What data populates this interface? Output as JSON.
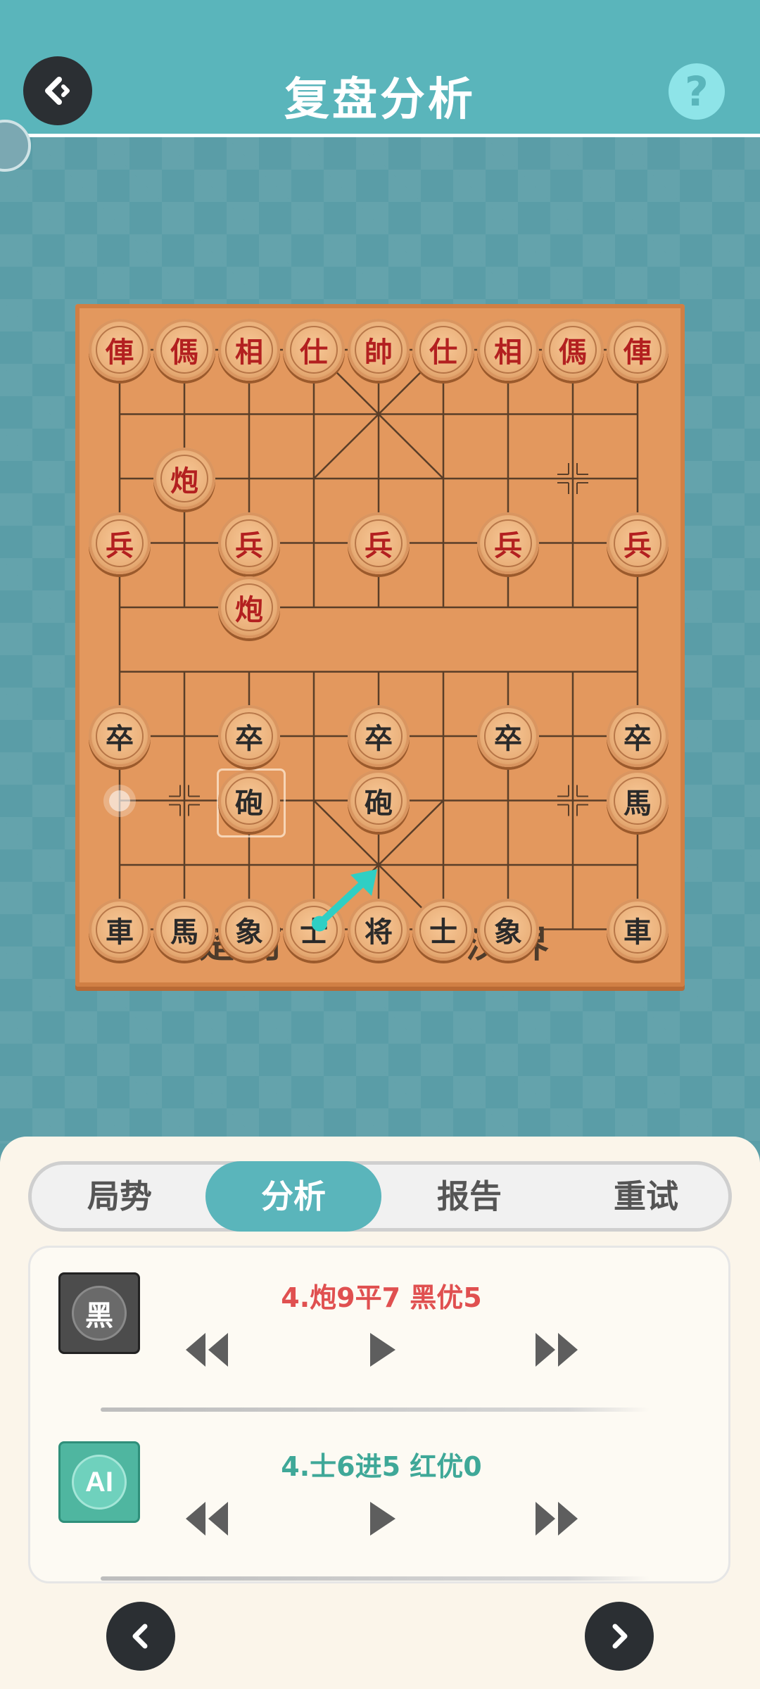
{
  "header": {
    "title": "复盘分析",
    "back_icon": "back-arrow-icon",
    "help_label": "?"
  },
  "board": {
    "river_left": "楚河",
    "river_right": "汉界",
    "red_pieces": [
      {
        "char": "俥",
        "file": 0,
        "rank": 0
      },
      {
        "char": "傌",
        "file": 1,
        "rank": 0
      },
      {
        "char": "相",
        "file": 2,
        "rank": 0
      },
      {
        "char": "仕",
        "file": 3,
        "rank": 0
      },
      {
        "char": "帥",
        "file": 4,
        "rank": 0
      },
      {
        "char": "仕",
        "file": 5,
        "rank": 0
      },
      {
        "char": "相",
        "file": 6,
        "rank": 0
      },
      {
        "char": "傌",
        "file": 7,
        "rank": 0
      },
      {
        "char": "俥",
        "file": 8,
        "rank": 0
      },
      {
        "char": "炮",
        "file": 1,
        "rank": 2
      },
      {
        "char": "兵",
        "file": 0,
        "rank": 3
      },
      {
        "char": "兵",
        "file": 2,
        "rank": 3
      },
      {
        "char": "兵",
        "file": 4,
        "rank": 3
      },
      {
        "char": "兵",
        "file": 6,
        "rank": 3
      },
      {
        "char": "兵",
        "file": 8,
        "rank": 3
      },
      {
        "char": "炮",
        "file": 2,
        "rank": 4
      }
    ],
    "black_pieces": [
      {
        "char": "卒",
        "file": 0,
        "rank": 6
      },
      {
        "char": "卒",
        "file": 2,
        "rank": 6
      },
      {
        "char": "卒",
        "file": 4,
        "rank": 6
      },
      {
        "char": "卒",
        "file": 6,
        "rank": 6
      },
      {
        "char": "卒",
        "file": 8,
        "rank": 6
      },
      {
        "char": "砲",
        "file": 2,
        "rank": 7
      },
      {
        "char": "砲",
        "file": 4,
        "rank": 7
      },
      {
        "char": "馬",
        "file": 8,
        "rank": 7
      },
      {
        "char": "車",
        "file": 0,
        "rank": 9
      },
      {
        "char": "馬",
        "file": 1,
        "rank": 9
      },
      {
        "char": "象",
        "file": 2,
        "rank": 9
      },
      {
        "char": "士",
        "file": 3,
        "rank": 9
      },
      {
        "char": "将",
        "file": 4,
        "rank": 9
      },
      {
        "char": "士",
        "file": 5,
        "rank": 9
      },
      {
        "char": "象",
        "file": 6,
        "rank": 9
      },
      {
        "char": "車",
        "file": 8,
        "rank": 9
      }
    ],
    "hint_arrow_color": "#2fcfc4"
  },
  "tabs": [
    {
      "label": "局势",
      "active": false
    },
    {
      "label": "分析",
      "active": true
    },
    {
      "label": "报告",
      "active": false
    },
    {
      "label": "重试",
      "active": false
    }
  ],
  "analysis": {
    "player_row": {
      "badge": "黑",
      "move": "4.炮9平7 黑优5",
      "move_color": "#e05050"
    },
    "ai_row": {
      "badge": "AI",
      "move": "4.士6进5 红优0",
      "move_color": "#3fa898"
    },
    "controls": [
      "rewind-icon",
      "play-icon",
      "fast-forward-icon"
    ]
  },
  "nav": {
    "prev_icon": "chevron-left-icon",
    "next_icon": "chevron-right-icon"
  }
}
